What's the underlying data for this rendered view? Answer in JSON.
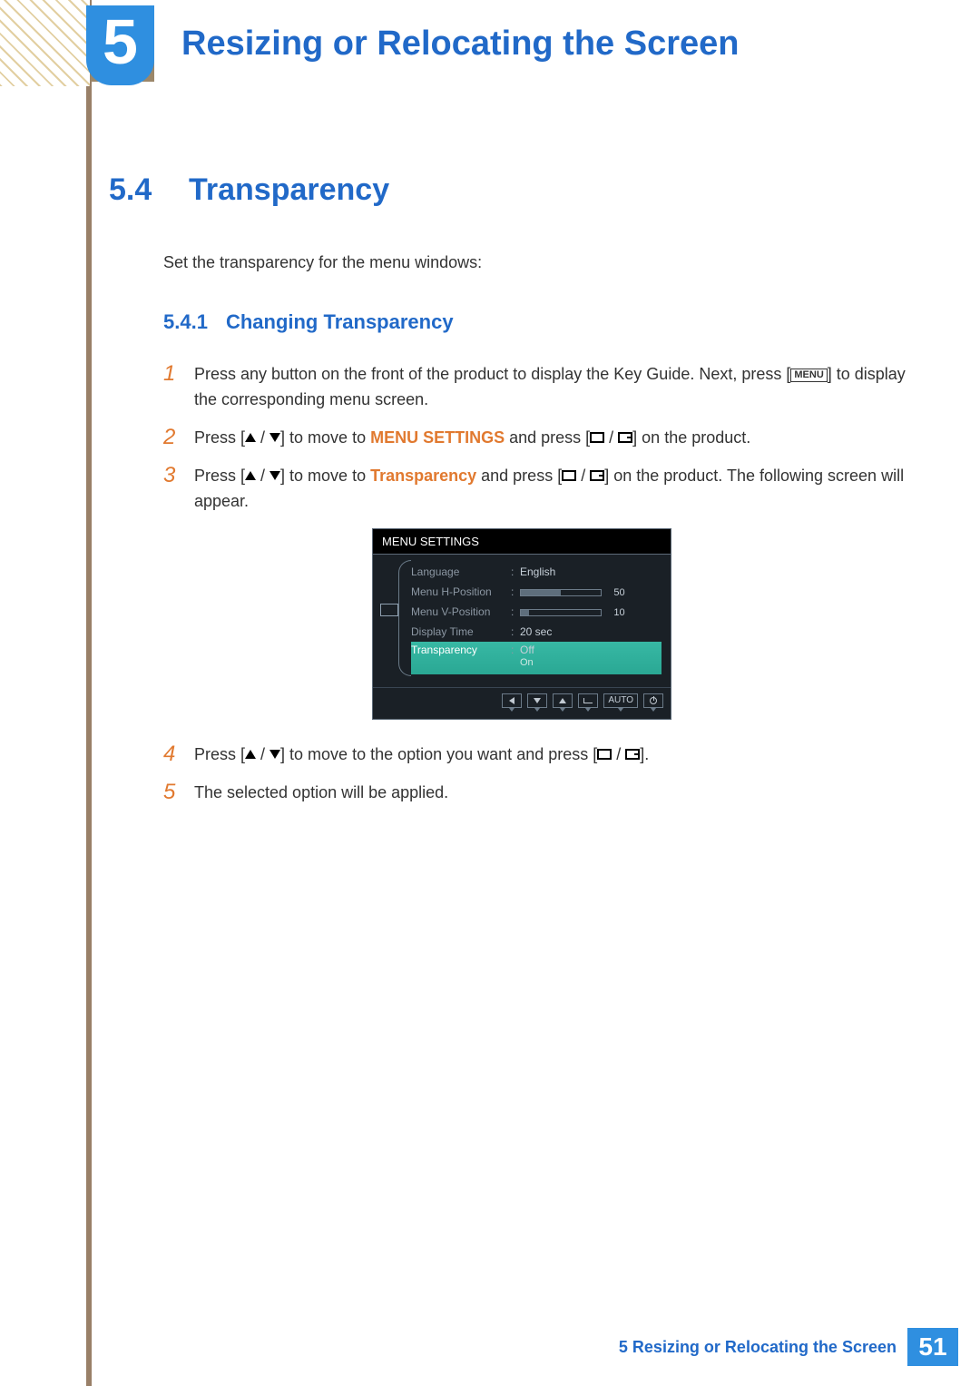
{
  "chapter": {
    "number": "5",
    "title": "Resizing or Relocating the Screen"
  },
  "section": {
    "number": "5.4",
    "title": "Transparency"
  },
  "intro": "Set the transparency for the menu windows:",
  "subsection": {
    "number": "5.4.1",
    "title": "Changing Transparency"
  },
  "menu_label": "MENU",
  "steps": {
    "s1": {
      "n": "1",
      "a": "Press any button on the front of the product to display the Key Guide. Next, press [",
      "b": "] to display the corresponding menu screen."
    },
    "s2": {
      "n": "2",
      "a": "Press [",
      "b": "] to move to ",
      "hl": "MENU SETTINGS",
      "c": " and press [",
      "d": "] on the product."
    },
    "s3": {
      "n": "3",
      "a": "Press [",
      "b": "] to move to ",
      "hl": "Transparency",
      "c": " and press [",
      "d": "] on the product. The following screen will appear."
    },
    "s4": {
      "n": "4",
      "a": "Press [",
      "b": "] to move to the option you want and press [",
      "c": "]."
    },
    "s5": {
      "n": "5",
      "a": "The selected option will be applied."
    }
  },
  "osd": {
    "title": "MENU SETTINGS",
    "rows": {
      "lang": {
        "label": "Language",
        "value": "English"
      },
      "hpos": {
        "label": "Menu H-Position",
        "value": "50",
        "fill": 50
      },
      "vpos": {
        "label": "Menu V-Position",
        "value": "10",
        "fill": 10
      },
      "dtime": {
        "label": "Display Time",
        "value": "20 sec"
      },
      "transp": {
        "label": "Transparency",
        "opt1": "Off",
        "opt2": "On"
      }
    },
    "auto": "AUTO"
  },
  "footer": {
    "text": "5 Resizing or Relocating the Screen",
    "page": "51"
  }
}
